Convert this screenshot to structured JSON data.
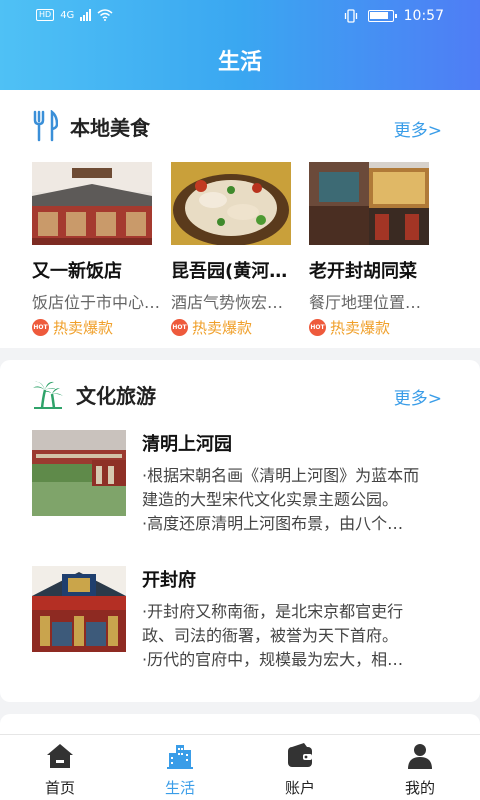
{
  "status_bar": {
    "network": "4G",
    "hd": "HD",
    "time": "10:57"
  },
  "header": {
    "title": "生活"
  },
  "food_section": {
    "title": "本地美食",
    "more": "更多>",
    "items": [
      {
        "name": "又一新饭店",
        "desc": "饭店位于市中心…",
        "hot": "热卖爆款"
      },
      {
        "name": "昆吾园(黄河…",
        "desc": "酒店气势恢宏…",
        "hot": "热卖爆款"
      },
      {
        "name": "老开封胡同菜",
        "desc": "餐厅地理位置…",
        "hot": "热卖爆款"
      }
    ]
  },
  "travel_section": {
    "title": "文化旅游",
    "more": "更多>",
    "items": [
      {
        "title": "清明上河园",
        "line1": "·根据宋朝名画《清明上河图》为蓝本而",
        "line2": "建造的大型宋代文化实景主题公园。",
        "line3": "·高度还原清明上河图布景，由八个…"
      },
      {
        "title": "开封府",
        "line1": "·开封府又称南衙，是北宋京都官吏行",
        "line2": "政、司法的衙署，被誉为天下首府。",
        "line3": "·历代的官府中，规模最为宏大，相…"
      }
    ]
  },
  "tabbar": {
    "tabs": [
      {
        "label": "首页"
      },
      {
        "label": "生活"
      },
      {
        "label": "账户"
      },
      {
        "label": "我的"
      }
    ],
    "active": "生活"
  },
  "colors": {
    "accent": "#3a9de8",
    "header_start": "#4fc1f5",
    "header_end": "#4f7df5",
    "hot": "#f0a02b"
  }
}
